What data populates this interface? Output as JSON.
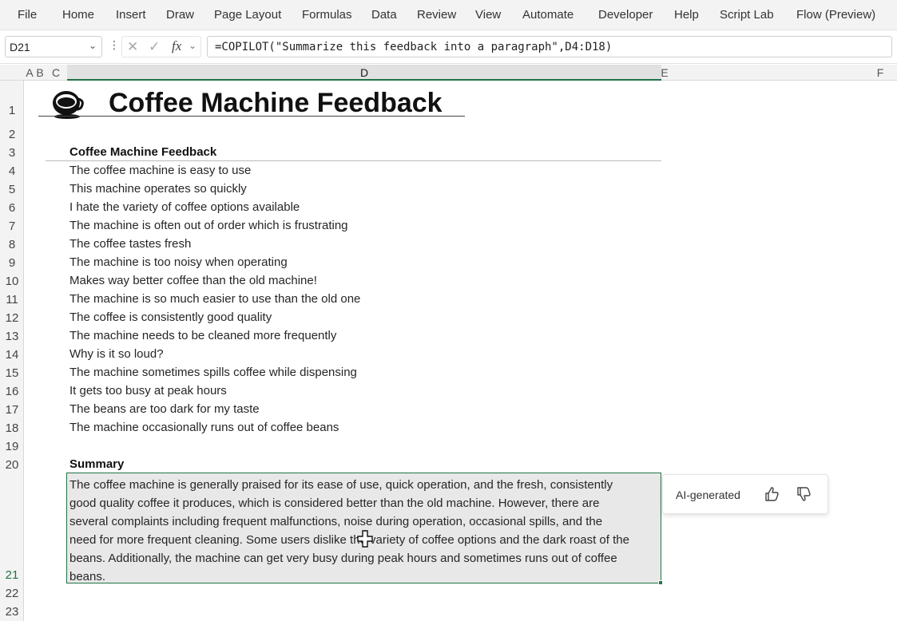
{
  "menu": [
    "File",
    "Home",
    "Insert",
    "Draw",
    "Page Layout",
    "Formulas",
    "Data",
    "Review",
    "View",
    "Automate",
    "Developer",
    "Help",
    "Script Lab",
    "Flow (Preview)"
  ],
  "formula_bar": {
    "name_box": "D21",
    "formula": "=COPILOT(\"Summarize this feedback into a paragraph\",D4:D18)",
    "fx_label": "fx"
  },
  "columns": [
    "A",
    "B",
    "C",
    "D",
    "E",
    "F"
  ],
  "rows": [
    "1",
    "2",
    "3",
    "4",
    "5",
    "6",
    "7",
    "8",
    "9",
    "10",
    "11",
    "12",
    "13",
    "14",
    "15",
    "16",
    "17",
    "18",
    "19",
    "20",
    "21",
    "22",
    "23"
  ],
  "sheet": {
    "title": "Coffee Machine Feedback",
    "feedback_header": "Coffee Machine Feedback",
    "feedback": [
      "The coffee machine is easy to use",
      "This machine operates so quickly",
      "I hate the variety of coffee options available",
      "The machine is often out of order which is frustrating",
      "The coffee tastes fresh",
      "The machine is too noisy when operating",
      "Makes way better coffee than the old machine!",
      "The machine is so much easier to use than the old one",
      "The coffee is consistently good quality",
      "The machine needs to be cleaned more frequently",
      "Why is it so loud?",
      "The machine sometimes spills coffee while dispensing",
      "It gets too busy at peak hours",
      "The beans are too dark for my taste",
      "The machine occasionally runs out of coffee beans"
    ],
    "summary_header": "Summary",
    "summary_lines": [
      "The coffee machine is generally praised for its ease of use, quick operation, and the fresh, consistently",
      "good quality coffee it produces, which is considered better than the old machine. However, there are",
      "several complaints including frequent malfunctions, noise during operation, occasional spills, and the",
      "need for more frequent cleaning. Some users dislike the variety of coffee options and the dark roast of the",
      "beans. Additionally, the machine can get very busy during peak hours and sometimes runs out of coffee",
      "beans."
    ]
  },
  "ai_card": {
    "label": "AI-generated",
    "thumbs_up_icon": "thumbs-up-icon",
    "thumbs_down_icon": "thumbs-down-icon"
  },
  "colors": {
    "accent": "#217346",
    "selection_fill": "#e8e8e8"
  }
}
